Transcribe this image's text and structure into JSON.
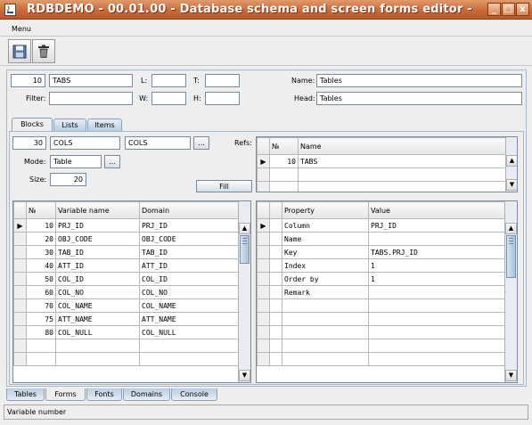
{
  "window": {
    "title": "RDBDEMO - 00.01.00 - Database schema and screen forms editor -",
    "buttons": {
      "minimize": "_",
      "maximize": "□",
      "close": "x"
    }
  },
  "menu": {
    "items": [
      "Menu"
    ]
  },
  "toolbar": {
    "save_icon": "floppy-disk-icon",
    "delete_icon": "trash-icon"
  },
  "form": {
    "id_value": "10",
    "code_value": "TABS",
    "labels": {
      "l": "L:",
      "t": "T:",
      "filter": "Filter:",
      "w": "W:",
      "h": "H:",
      "name": "Name:",
      "head": "Head:"
    },
    "l_value": "",
    "t_value": "",
    "filter_value": "",
    "w_value": "",
    "h_value": "",
    "name_value": "Tables",
    "head_value": "Tables"
  },
  "tabs": [
    "Blocks",
    "Lists",
    "Items"
  ],
  "active_tab": "Blocks",
  "blocks": {
    "num_value": "30",
    "code_value": "COLS",
    "code2_value": "COLS",
    "ellipsis": "...",
    "mode_label": "Mode:",
    "mode_value": "Table",
    "size_label": "Size:",
    "size_value": "20",
    "fill_button": "Fill",
    "refs_label": "Refs:"
  },
  "refs_table": {
    "columns": [
      "№",
      "Name"
    ],
    "rows": [
      {
        "marker": "▶",
        "num": "10",
        "name": "TABS"
      },
      {
        "marker": "",
        "num": "",
        "name": ""
      },
      {
        "marker": "",
        "num": "",
        "name": ""
      }
    ]
  },
  "vars_table": {
    "columns": [
      "№",
      "Variable name",
      "Domain"
    ],
    "rows": [
      {
        "marker": "▶",
        "num": "10",
        "name": "PRJ_ID",
        "domain": "PRJ_ID"
      },
      {
        "marker": "",
        "num": "20",
        "name": "OBJ_CODE",
        "domain": "OBJ_CODE"
      },
      {
        "marker": "",
        "num": "30",
        "name": "TAB_ID",
        "domain": "TAB_ID"
      },
      {
        "marker": "",
        "num": "40",
        "name": "ATT_ID",
        "domain": "ATT_ID"
      },
      {
        "marker": "",
        "num": "50",
        "name": "COL_ID",
        "domain": "COL_ID"
      },
      {
        "marker": "",
        "num": "60",
        "name": "COL_NO",
        "domain": "COL_NO"
      },
      {
        "marker": "",
        "num": "70",
        "name": "COL_NAME",
        "domain": "COL_NAME"
      },
      {
        "marker": "",
        "num": "75",
        "name": "ATT_NAME",
        "domain": "ATT_NAME"
      },
      {
        "marker": "",
        "num": "80",
        "name": "COL_NULL",
        "domain": "COL_NULL"
      },
      {
        "marker": "",
        "num": "",
        "name": "",
        "domain": ""
      },
      {
        "marker": "",
        "num": "",
        "name": "",
        "domain": ""
      }
    ]
  },
  "props_table": {
    "columns": [
      "Property",
      "Value"
    ],
    "rows": [
      {
        "marker": "▶",
        "property": "Column",
        "value": "PRJ_ID"
      },
      {
        "marker": "",
        "property": "Name",
        "value": ""
      },
      {
        "marker": "",
        "property": "Key",
        "value": "TABS.PRJ_ID"
      },
      {
        "marker": "",
        "property": "Index",
        "value": "1"
      },
      {
        "marker": "",
        "property": "Order by",
        "value": "1"
      },
      {
        "marker": "",
        "property": "Remark",
        "value": ""
      },
      {
        "marker": "",
        "property": "",
        "value": ""
      },
      {
        "marker": "",
        "property": "",
        "value": ""
      },
      {
        "marker": "",
        "property": "",
        "value": ""
      },
      {
        "marker": "",
        "property": "",
        "value": ""
      },
      {
        "marker": "",
        "property": "",
        "value": ""
      }
    ]
  },
  "bottom_tabs": [
    "Tables",
    "Forms",
    "Fonts",
    "Domains",
    "Console"
  ],
  "active_bottom_tab": "Forms",
  "status": {
    "text": "Variable number"
  },
  "colors": {
    "titlebar": "#c96a3a",
    "tab_blue": "#b8cde0",
    "panel_bg": "#eeeeee"
  }
}
